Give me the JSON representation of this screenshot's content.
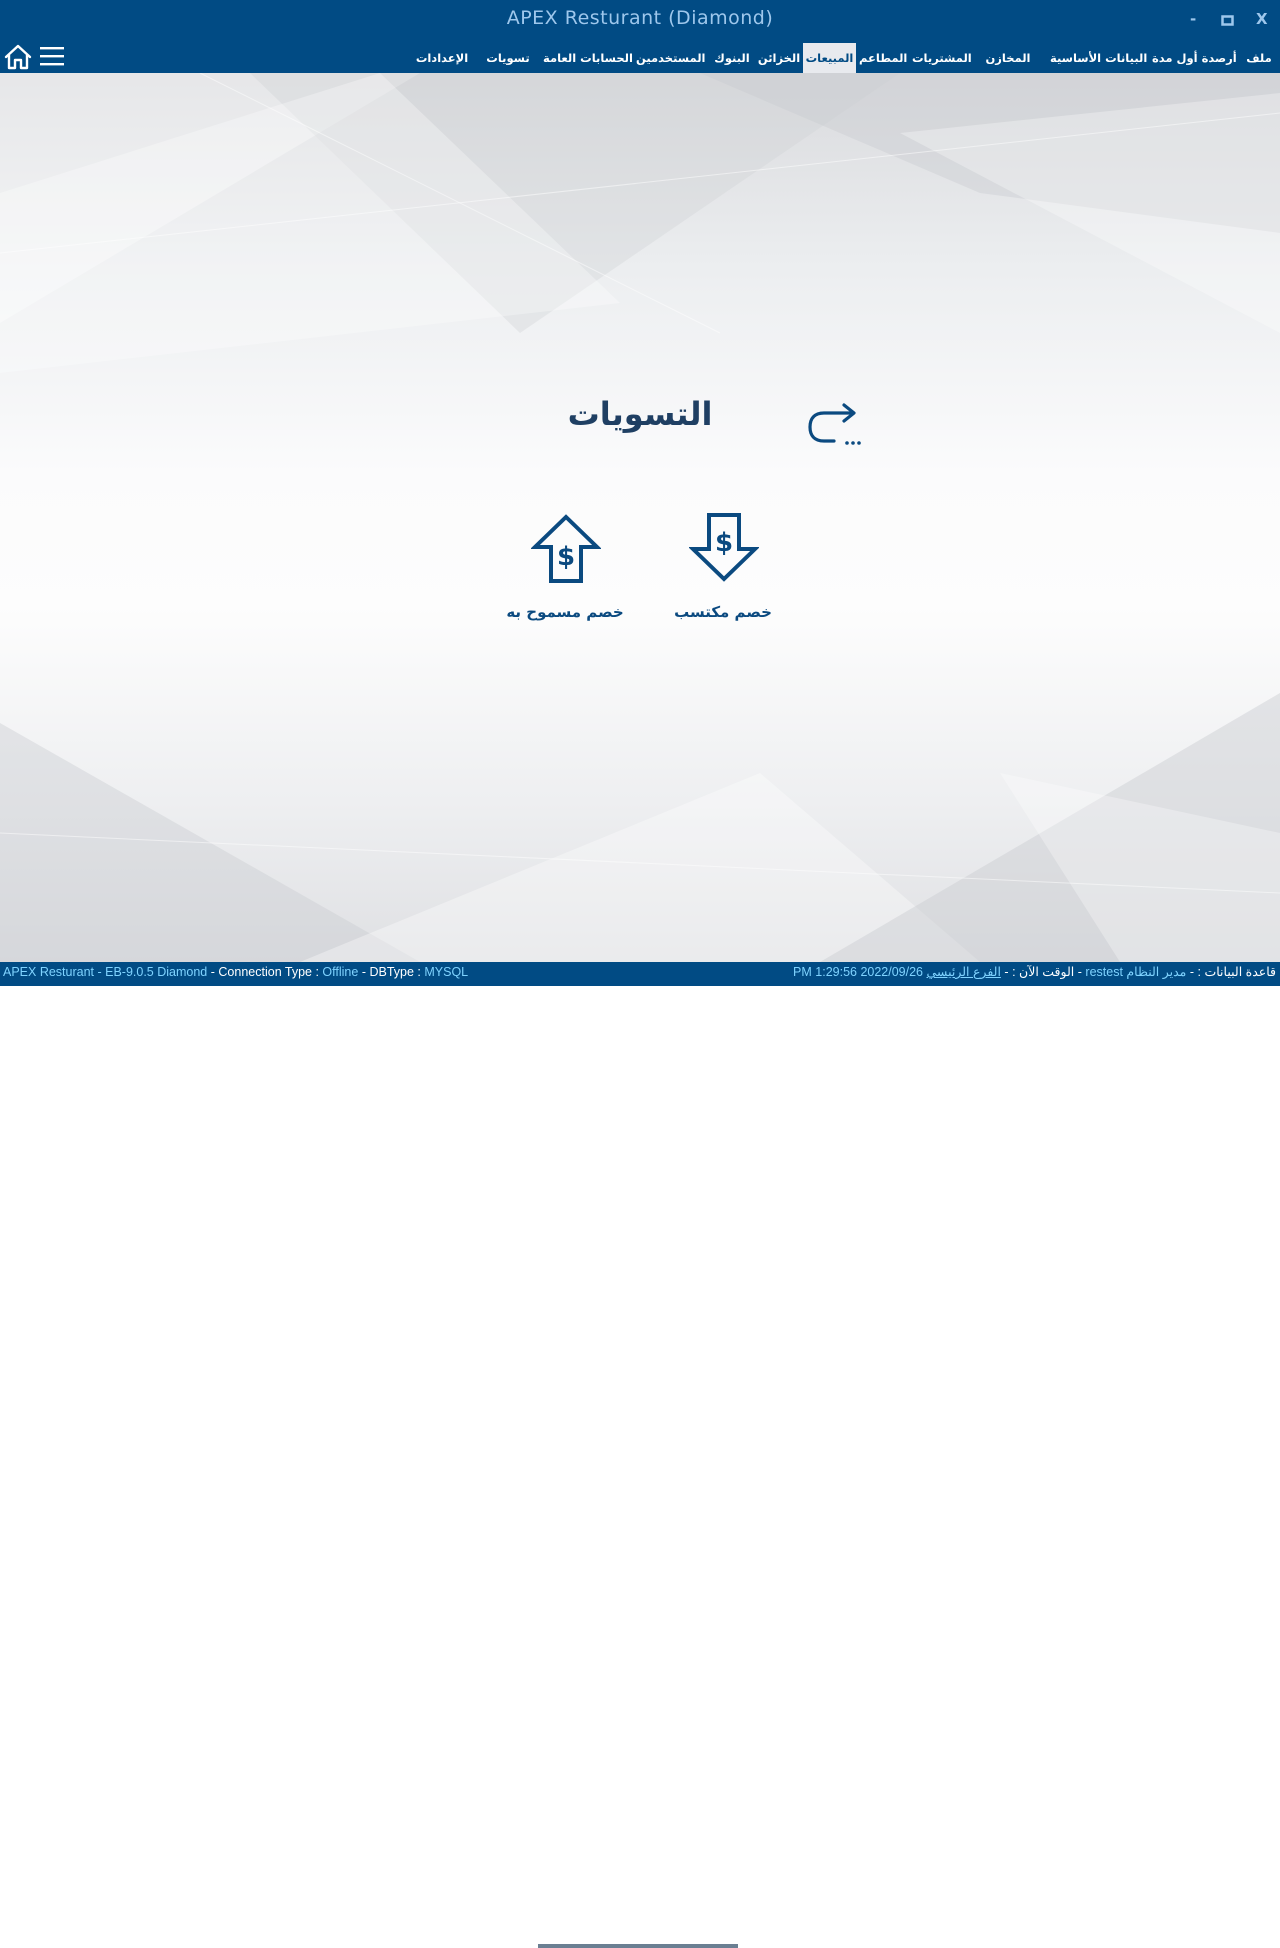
{
  "window": {
    "title": "APEX Resturant (Diamond)",
    "minimize_label": "-",
    "maximize_label": "□",
    "close_label": "X"
  },
  "menu": {
    "items": [
      {
        "label": "ملف"
      },
      {
        "label": "أرصدة أول مدة"
      },
      {
        "label": "البيانات الأساسية"
      },
      {
        "label": "المخازن"
      },
      {
        "label": "المشتريات"
      },
      {
        "label": "المطاعم"
      },
      {
        "label": "المبيعات",
        "active": true
      },
      {
        "label": "الخزائن"
      },
      {
        "label": "البنوك"
      },
      {
        "label": "المستخدمين"
      },
      {
        "label": "الحسابات العامة"
      },
      {
        "label": "تسويات"
      },
      {
        "label": "الإعدادات"
      }
    ],
    "home_icon": "home-icon",
    "hamburger_icon": "hamburger-icon"
  },
  "main": {
    "section_title": "التسويات",
    "back_icon": "return-arrow-icon",
    "tiles": [
      {
        "label": "خصم مكتسب",
        "icon": "dollar-arrow-down-icon"
      },
      {
        "label": "خصم مسموح به",
        "icon": "dollar-arrow-up-icon"
      }
    ]
  },
  "status": {
    "app_version": "APEX Resturant - EB-9.0.5  Diamond",
    "sep": "-",
    "connection_label": "Connection Type :",
    "connection_value": "Offline",
    "dbtype_label": "DBType :",
    "dbtype_value": "MYSQL",
    "datetime_value": "PM 1:29:56 2022/09/26",
    "time_label": "الوقت الآن :",
    "branch_value": "الفرع الرئيسي",
    "db_value": "restest",
    "db_label": "قاعدة البيانات :",
    "user_value": "مدير النظام"
  },
  "colors": {
    "primary": "#014b84",
    "title_text": "#9ec7ec",
    "status_value": "#7fd3ff",
    "active_tab_bg": "#e8eaee",
    "heading": "#1f3f63"
  }
}
